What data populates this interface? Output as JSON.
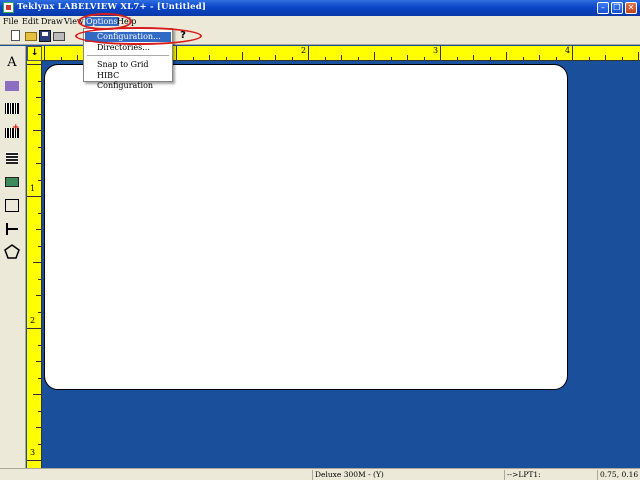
{
  "window": {
    "title": "Teklynx LABELVIEW XL7+ - [Untitled]"
  },
  "menu": {
    "items": [
      "File",
      "Edit",
      "Draw",
      "View",
      "Options",
      "Help"
    ],
    "active": "Options"
  },
  "options_menu": {
    "items": [
      "Configuration...",
      "Directories...",
      "Snap to Grid",
      "HIBC Configuration"
    ],
    "selected": "Configuration..."
  },
  "palette": {
    "text_tool": "A"
  },
  "ruler": {
    "h_labels": [
      "2",
      "3",
      "4"
    ],
    "v_labels": [
      "1",
      "2",
      "3"
    ]
  },
  "status": {
    "printer": "Deluxe 300M - (Y)",
    "port": "-->LPT1:",
    "coords": "0.75, 0.16"
  },
  "colors": {
    "workspace": "#1a4f9c",
    "ruler": "#ffff00",
    "annotation": "#d81c1c",
    "menu_highlight": "#316ac5"
  },
  "icons": [
    "app-icon",
    "new-document-icon",
    "open-folder-icon",
    "save-icon",
    "print-icon",
    "help-icon",
    "text-tool-icon",
    "graphic-text-icon",
    "barcode-icon",
    "hibc-barcode-icon",
    "2d-barcode-icon",
    "image-tool-icon",
    "rectangle-tool-icon",
    "line-tool-icon",
    "polygon-tool-icon"
  ]
}
